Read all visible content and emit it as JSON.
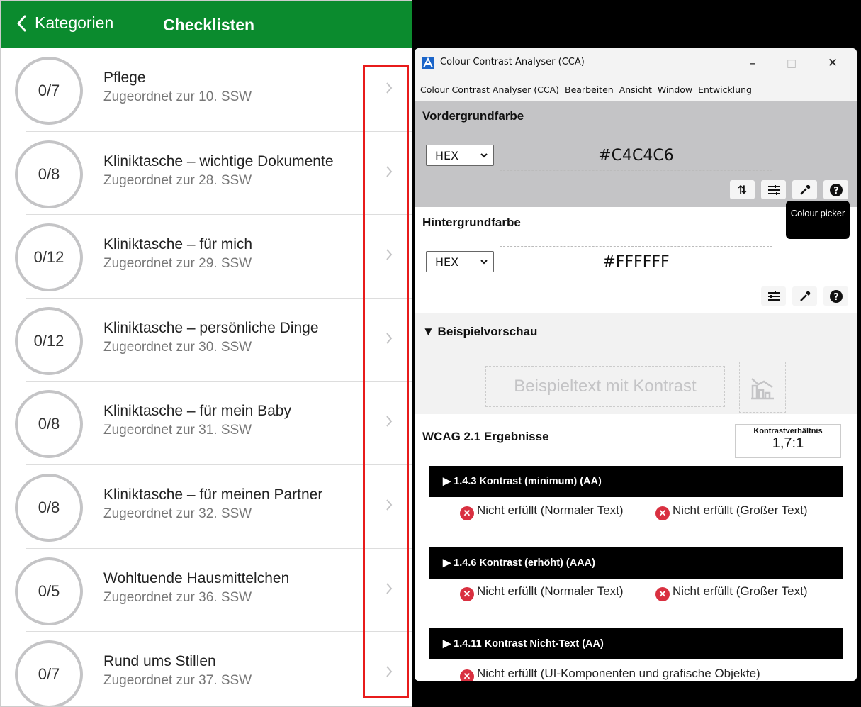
{
  "app": {
    "back_label": "Kategorien",
    "title": "Checklisten",
    "accent": "#0b8b2e",
    "items": [
      {
        "progress": "0/7",
        "title": "Pflege",
        "subtitle": "Zugeordnet zur 10. SSW"
      },
      {
        "progress": "0/8",
        "title": "Kliniktasche – wichtige Dokumente",
        "subtitle": "Zugeordnet zur 28. SSW"
      },
      {
        "progress": "0/12",
        "title": "Kliniktasche – für mich",
        "subtitle": "Zugeordnet zur 29. SSW"
      },
      {
        "progress": "0/12",
        "title": "Kliniktasche – persönliche Dinge",
        "subtitle": "Zugeordnet zur 30. SSW"
      },
      {
        "progress": "0/8",
        "title": "Kliniktasche – für mein Baby",
        "subtitle": "Zugeordnet zur 31. SSW"
      },
      {
        "progress": "0/8",
        "title": "Kliniktasche – für meinen Partner",
        "subtitle": "Zugeordnet zur 32. SSW"
      },
      {
        "progress": "0/5",
        "title": "Wohltuende Hausmittelchen",
        "subtitle": "Zugeordnet zur 36. SSW"
      },
      {
        "progress": "0/7",
        "title": "Rund ums Stillen",
        "subtitle": "Zugeordnet zur 37. SSW"
      }
    ]
  },
  "cca": {
    "window_title": "Colour Contrast Analyser (CCA)",
    "window_controls": {
      "minimize": "–",
      "maximize": "□",
      "close": "✕"
    },
    "menu": [
      "Colour Contrast Analyser (CCA)",
      "Bearbeiten",
      "Ansicht",
      "Window",
      "Entwicklung"
    ],
    "foreground": {
      "heading": "Vordergrundfarbe",
      "format": "HEX",
      "value": "#C4C4C6",
      "color": "#C4C4C6"
    },
    "background": {
      "heading": "Hintergrundfarbe",
      "format": "HEX",
      "value": "#FFFFFF",
      "color": "#FFFFFF"
    },
    "tooltip": "Colour picker",
    "preview": {
      "heading": "▼ Beispielvorschau",
      "sample_text": "Beispieltext mit Kontrast"
    },
    "results": {
      "heading": "WCAG 2.1 Ergebnisse",
      "ratio_label": "Kontrastverhältnis",
      "ratio": "1,7:1",
      "criteria": [
        {
          "label": "▶ 1.4.3 Kontrast (minimum) (AA)",
          "normal": "Nicht erfüllt (Normaler Text)",
          "large": "Nicht erfüllt (Großer Text)"
        },
        {
          "label": "▶ 1.4.6 Kontrast (erhöht) (AAA)",
          "normal": "Nicht erfüllt (Normaler Text)",
          "large": "Nicht erfüllt (Großer Text)"
        },
        {
          "label": "▶ 1.4.11 Kontrast Nicht-Text (AA)",
          "ui": "Nicht erfüllt (UI-Komponenten und grafische Objekte)"
        }
      ]
    }
  }
}
